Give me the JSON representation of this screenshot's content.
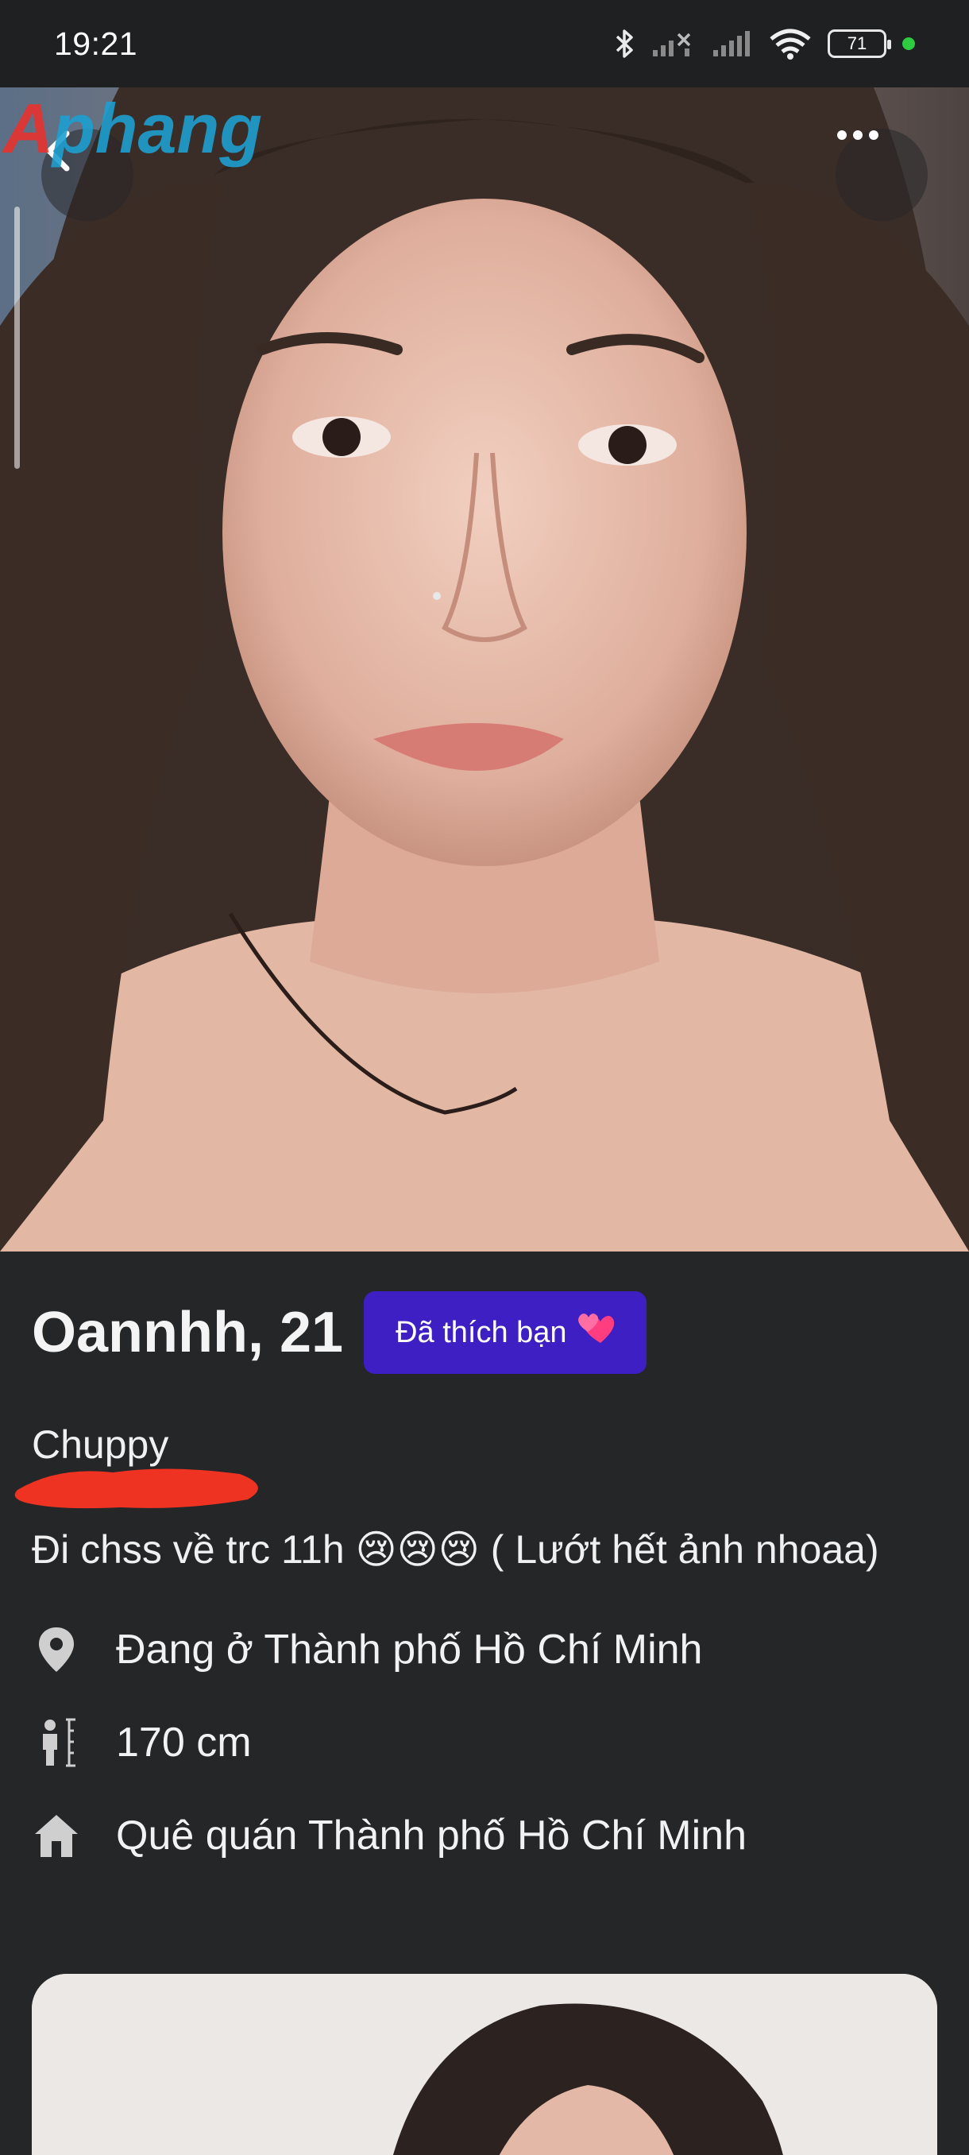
{
  "status_bar": {
    "time": "19:21",
    "battery": "71",
    "icons": [
      "bluetooth-icon",
      "signal-x-icon",
      "signal-icon",
      "wifi-icon",
      "battery-icon",
      "green-dot"
    ]
  },
  "photo": {
    "watermark": "Aphang",
    "back_icon": "chevron-left-icon",
    "more_icon": "more-horizontal-icon"
  },
  "profile": {
    "name": "Oannhh, 21",
    "liked_badge": "Đã thích bạn",
    "liked_emoji": "💕",
    "bio_line1": "Chuppy",
    "bio_line2": "Đi chss về trc 11h 😢😢😢 ( Lướt hết ảnh nhoaa)",
    "location": "Đang ở Thành phố Hồ Chí Minh",
    "height": "170 cm",
    "hometown": "Quê quán Thành phố Hồ Chí Minh"
  },
  "colors": {
    "background": "#252628",
    "badge": "#3d1fc4",
    "status_green": "#2ecc40",
    "redaction": "#ee3322"
  }
}
